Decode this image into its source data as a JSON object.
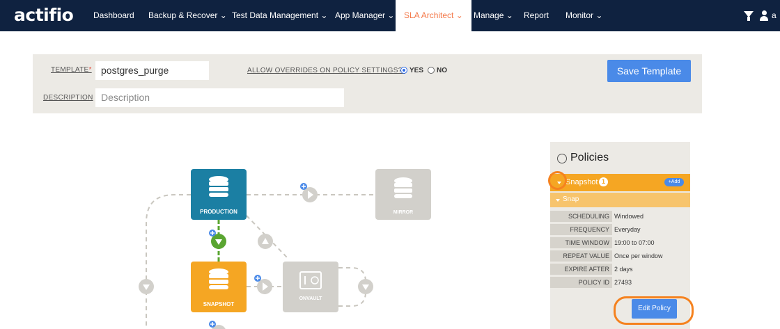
{
  "app": {
    "logo": "actifio",
    "user_initial": "a"
  },
  "nav": {
    "items": [
      {
        "label": "Dashboard"
      },
      {
        "label": "Backup & Recover ⌄"
      },
      {
        "label": "Test Data Management ⌄"
      },
      {
        "label": "App Manager ⌄"
      },
      {
        "label": "SLA Architect ⌄"
      },
      {
        "label": "Manage ⌄"
      },
      {
        "label": "Report"
      },
      {
        "label": "Monitor ⌄"
      }
    ],
    "active_index": 4
  },
  "form": {
    "template_label": "TEMPLATE",
    "required_mark": "*",
    "template_value": "postgres_purge",
    "override_label": "ALLOW OVERRIDES ON POLICY SETTINGS?",
    "override_options": {
      "yes": "YES",
      "no": "NO"
    },
    "override_selected": "yes",
    "description_label": "DESCRIPTION",
    "description_placeholder": "Description",
    "save_button": "Save Template"
  },
  "diagram": {
    "nodes": {
      "production": "PRODUCTION",
      "mirror": "MIRROR",
      "snapshot": "SNAPSHOT",
      "onvault": "ONVAULT"
    },
    "colors": {
      "production": "#1b7fa3",
      "snapshot": "#f5a623",
      "inactive": "#d2d0cb",
      "connector_active": "#5aa531"
    }
  },
  "policies": {
    "title": "Policies",
    "group": {
      "label": "Snapshot",
      "count": "1",
      "add_label": "+Add"
    },
    "policy": {
      "label": "Snap"
    },
    "rows": [
      {
        "key": "SCHEDULING",
        "value": "Windowed"
      },
      {
        "key": "FREQUENCY",
        "value": "Everyday"
      },
      {
        "key": "TIME WINDOW",
        "value": "19:00 to 07:00"
      },
      {
        "key": "REPEAT VALUE",
        "value": "Once per window"
      },
      {
        "key": "EXPIRE AFTER",
        "value": "2 days"
      },
      {
        "key": "POLICY ID",
        "value": "27493"
      }
    ],
    "edit_button": "Edit Policy",
    "highlight_color": "#f5821f"
  }
}
